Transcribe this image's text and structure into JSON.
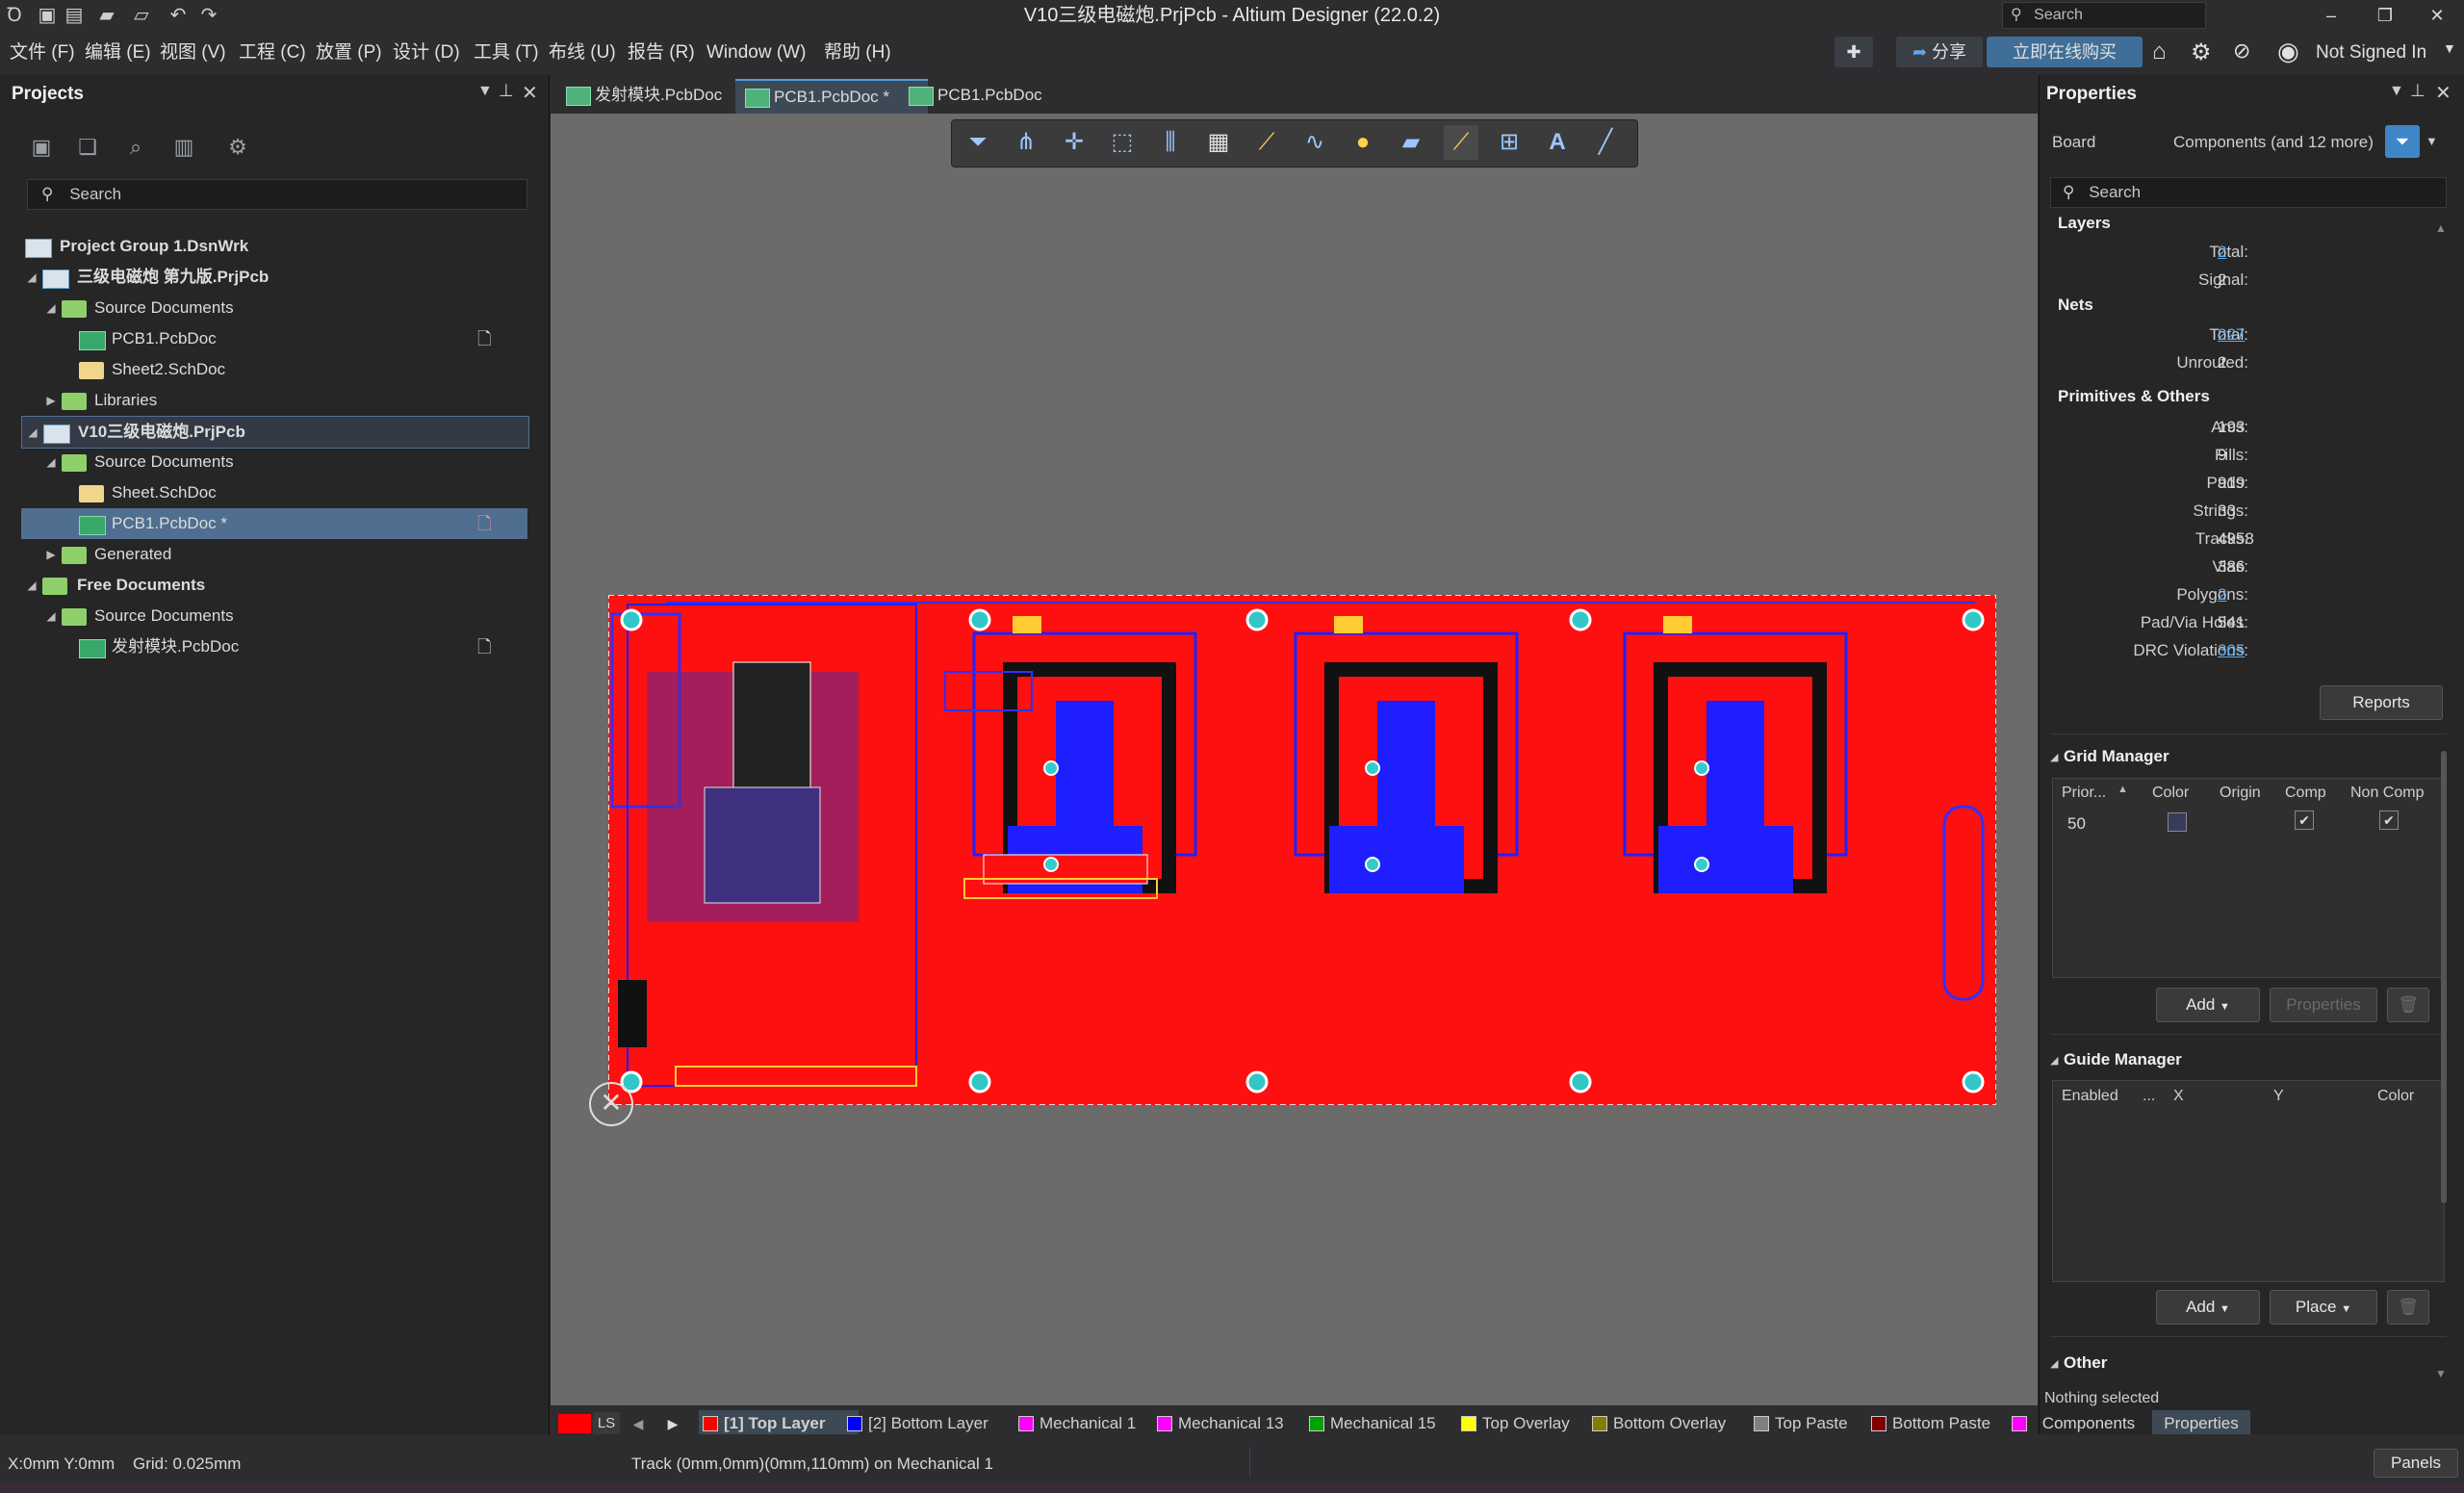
{
  "window": {
    "title": "V10三级电磁炮.PrjPcb - Altium Designer (22.0.2)",
    "search_placeholder": "Search"
  },
  "menu": {
    "items": [
      "文件 (F)",
      "编辑 (E)",
      "视图 (V)",
      "工程 (C)",
      "放置 (P)",
      "设计 (D)",
      "工具 (T)",
      "布线 (U)",
      "报告 (R)",
      "Window (W)",
      "帮助 (H)"
    ],
    "share_label": "分享",
    "buy_label": "立即在线购买",
    "user_label": "Not Signed In"
  },
  "projects_panel": {
    "title": "Projects",
    "search_placeholder": "Search",
    "tree": [
      {
        "label": "Project Group 1.DsnWrk",
        "level": 0,
        "bold": true
      },
      {
        "label": "三级电磁炮 第九版.PrjPcb",
        "level": 1,
        "bold": true
      },
      {
        "label": "Source Documents",
        "level": 2
      },
      {
        "label": "PCB1.PcbDoc",
        "level": 3
      },
      {
        "label": "Sheet2.SchDoc",
        "level": 3
      },
      {
        "label": "Libraries",
        "level": 2
      },
      {
        "label": "V10三级电磁炮.PrjPcb",
        "level": 1,
        "bold": true
      },
      {
        "label": "Source Documents",
        "level": 2
      },
      {
        "label": "Sheet.SchDoc",
        "level": 3
      },
      {
        "label": "PCB1.PcbDoc *",
        "level": 3
      },
      {
        "label": "Generated",
        "level": 2
      },
      {
        "label": "Free Documents",
        "level": 1,
        "bold": true
      },
      {
        "label": "Source Documents",
        "level": 2
      },
      {
        "label": "发射模块.PcbDoc",
        "level": 3
      }
    ]
  },
  "tabs": [
    {
      "label": "发射模块.PcbDoc"
    },
    {
      "label": "PCB1.PcbDoc *",
      "active": true
    },
    {
      "label": "PCB1.PcbDoc"
    }
  ],
  "layers": [
    {
      "label": "[1] Top Layer",
      "color": "#ff0000",
      "active": true
    },
    {
      "label": "[2] Bottom Layer",
      "color": "#0000ff"
    },
    {
      "label": "Mechanical 1",
      "color": "#ff00ff"
    },
    {
      "label": "Mechanical 13",
      "color": "#ff00ff"
    },
    {
      "label": "Mechanical 15",
      "color": "#00a000"
    },
    {
      "label": "Top Overlay",
      "color": "#ffff00"
    },
    {
      "label": "Bottom Overlay",
      "color": "#808000"
    },
    {
      "label": "Top Paste",
      "color": "#808080"
    },
    {
      "label": "Bottom Paste",
      "color": "#800000"
    }
  ],
  "layerbar": {
    "ls_label": "LS"
  },
  "properties": {
    "title": "Properties",
    "board_label": "Board",
    "filter_label": "Components (and 12 more)",
    "search_placeholder": "Search",
    "layers_section": "Layers",
    "layers_rows": [
      {
        "label": "Total:",
        "value": "2",
        "link": true
      },
      {
        "label": "Signal:",
        "value": "2"
      }
    ],
    "nets_section": "Nets",
    "nets_rows": [
      {
        "label": "Total:",
        "value": "227",
        "link": true
      },
      {
        "label": "Unrouted:",
        "value": "2"
      }
    ],
    "prims_section": "Primitives & Others",
    "prims_rows": [
      {
        "label": "Arcs:",
        "value": "193"
      },
      {
        "label": "Fills:",
        "value": "9"
      },
      {
        "label": "Pads:",
        "value": "919"
      },
      {
        "label": "Strings:",
        "value": "33"
      },
      {
        "label": "Tracks:",
        "value": "4958"
      },
      {
        "label": "Vias:",
        "value": "386"
      },
      {
        "label": "Polygons:",
        "value": "2",
        "link": true
      },
      {
        "label": "Pad/Via Holes:",
        "value": "541"
      },
      {
        "label": "DRC Violations:",
        "value": "305",
        "link": true
      }
    ],
    "reports_label": "Reports",
    "grid_manager": {
      "title": "Grid Manager",
      "columns": [
        "Prior...",
        "Color",
        "Origin",
        "Comp",
        "Non Comp"
      ],
      "row": {
        "priority": "50"
      },
      "add_label": "Add",
      "properties_label": "Properties"
    },
    "guide_manager": {
      "title": "Guide Manager",
      "columns": [
        "Enabled",
        "...",
        "X",
        "Y",
        "Color"
      ],
      "add_label": "Add",
      "place_label": "Place"
    },
    "other_section": "Other",
    "nothing_selected": "Nothing selected",
    "bottom_tabs": [
      "Components",
      "Properties"
    ]
  },
  "status": {
    "coords": "X:0mm Y:0mm",
    "grid": "Grid: 0.025mm",
    "message": "Track (0mm,0mm)(0mm,110mm) on Mechanical 1",
    "panels_label": "Panels"
  }
}
